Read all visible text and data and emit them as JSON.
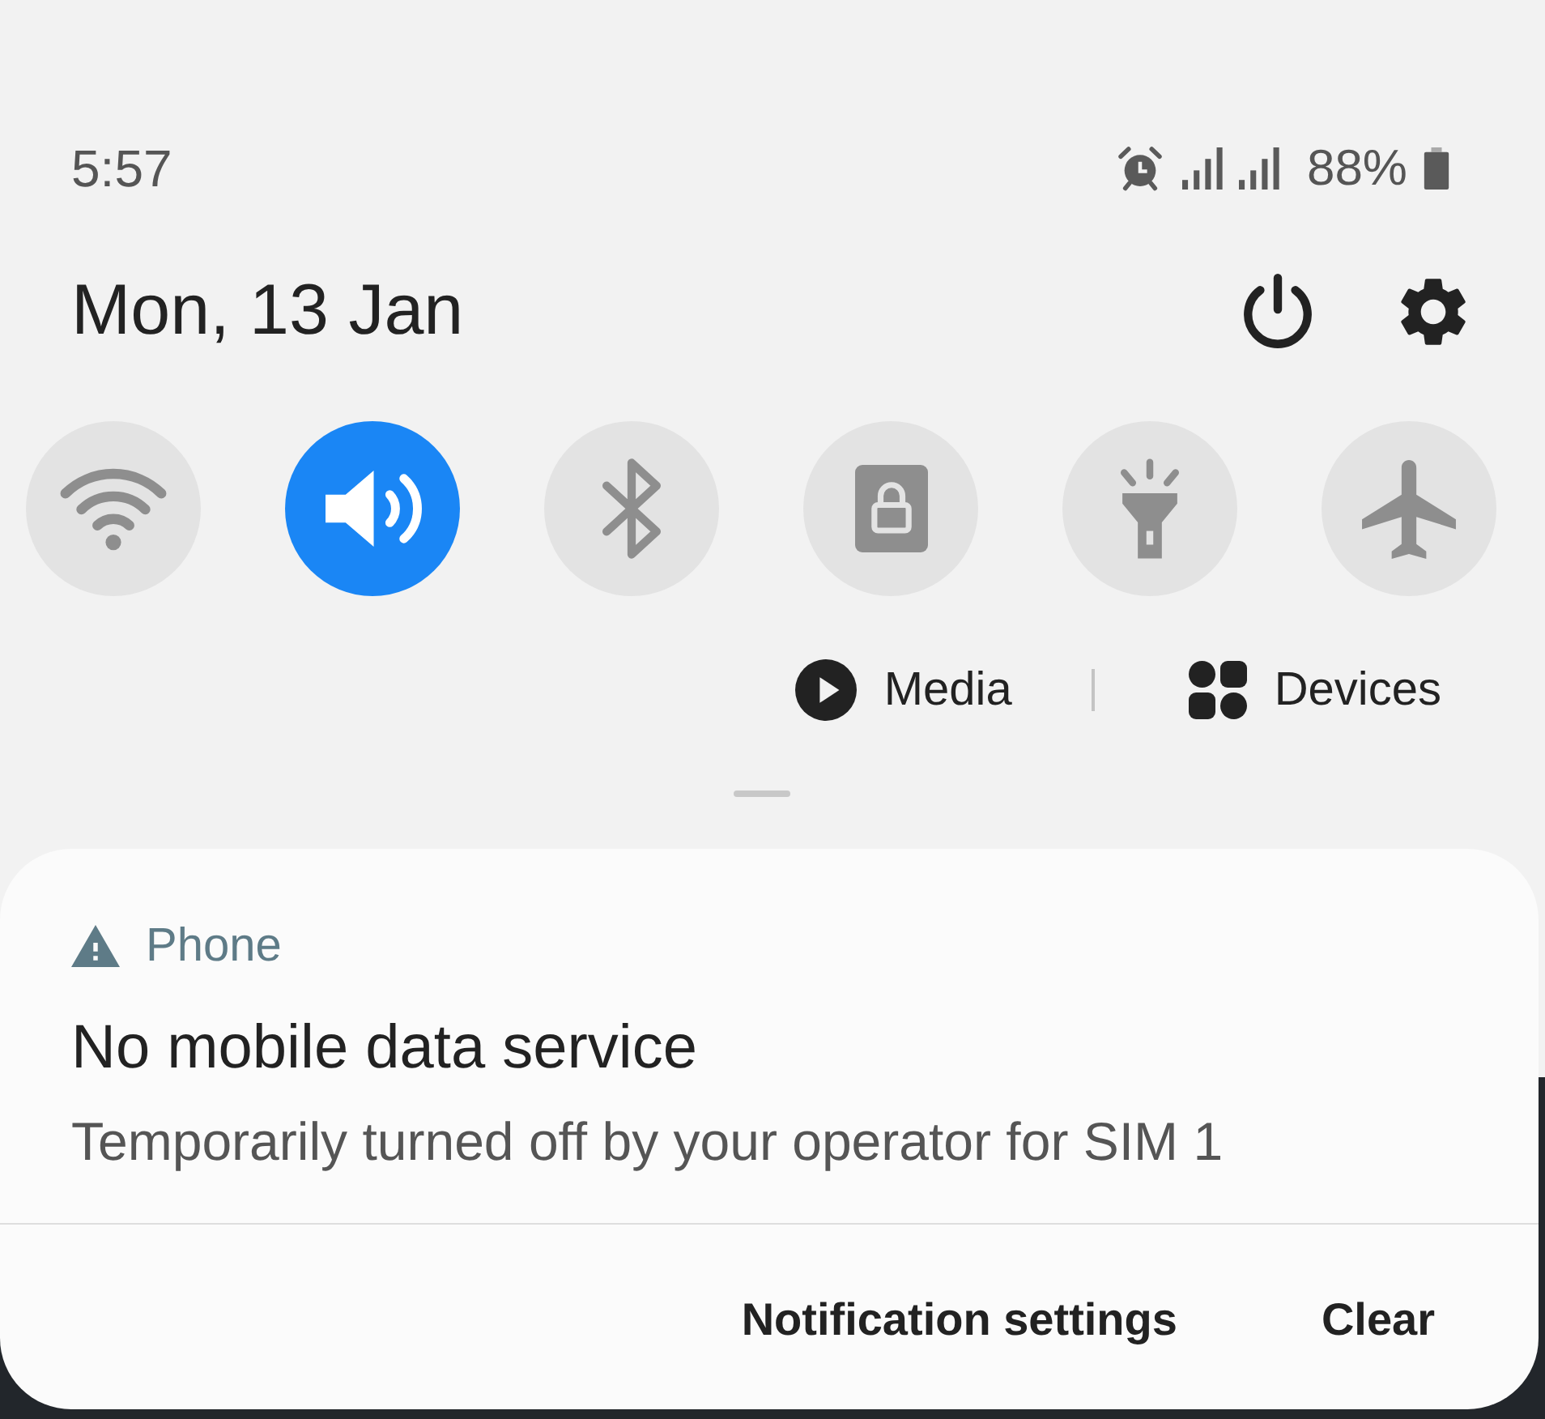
{
  "status_bar": {
    "time": "5:57",
    "battery": "88%"
  },
  "header": {
    "date": "Mon, 13 Jan"
  },
  "quick_toggles": [
    {
      "kind": "wifi",
      "on": false
    },
    {
      "kind": "sound",
      "on": true
    },
    {
      "kind": "bluetooth",
      "on": false
    },
    {
      "kind": "lock",
      "on": false
    },
    {
      "kind": "flashlight",
      "on": false
    },
    {
      "kind": "airplane",
      "on": false
    }
  ],
  "output_buttons": [
    {
      "kind": "media",
      "label": "Media"
    },
    {
      "kind": "devices",
      "label": "Devices"
    }
  ],
  "notification": {
    "app": "Phone",
    "title": "No mobile data service",
    "text": "Temporarily turned off by your operator for SIM 1",
    "actions": [
      "Notification settings",
      "Clear"
    ]
  }
}
